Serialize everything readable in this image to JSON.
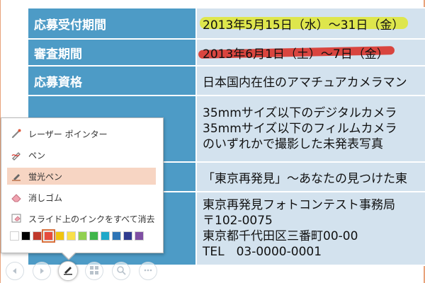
{
  "table": {
    "rows": [
      {
        "label": "応募受付期間",
        "value": "2013年5月15日（水）～31日（金）"
      },
      {
        "label": "審査期間",
        "value": "2013年6月1日（土）～7日（金）"
      },
      {
        "label": "応募資格",
        "value": "日本国内在住のアマチュアカメラマン"
      },
      {
        "label": "",
        "lines": [
          "35mmサイズ以下のデジタルカメラ",
          "35mmサイズ以下のフィルムカメラ",
          "のいずれかで撮影した未発表写真"
        ]
      },
      {
        "label": "",
        "value": "「東京再発見」～あなたの見つけた東"
      },
      {
        "label": "",
        "lines": [
          "東京再発見フォトコンテスト事務局",
          "〒102-0075",
          "東京都千代田区三番町00-00",
          "TEL　03-0000-0001"
        ]
      }
    ]
  },
  "pen_menu": {
    "items": [
      {
        "label": "レーザー ポインター",
        "icon": "laser-pointer-icon"
      },
      {
        "label": "ペン",
        "icon": "pen-icon"
      },
      {
        "label": "蛍光ペン",
        "icon": "highlighter-icon",
        "selected": true
      },
      {
        "label": "消しゴム",
        "icon": "eraser-icon"
      },
      {
        "label": "スライド上のインクをすべて消去",
        "icon": "erase-all-ink-icon"
      }
    ],
    "colors": [
      "#ffffff",
      "#000000",
      "#c0392b",
      "#e74c3c",
      "#f1c40f",
      "#f9e04a",
      "#92d050",
      "#3fb54a",
      "#1fa8c9",
      "#2e75b6",
      "#2f3c8f",
      "#7f4fa3"
    ],
    "selected_color_index": 3
  },
  "toolbar": {
    "buttons": [
      "previous-icon",
      "next-icon",
      "pen-tool-icon",
      "slides-grid-icon",
      "zoom-icon",
      "more-options-icon"
    ],
    "active": "pen-tool-icon"
  },
  "colors": {
    "header_blue": "#4d9bc6",
    "cell_light": "#d3e2ee",
    "highlight_yellow": "#dfe73a",
    "highlight_red": "#d9342b",
    "menu_selected": "#f7d5c3"
  }
}
